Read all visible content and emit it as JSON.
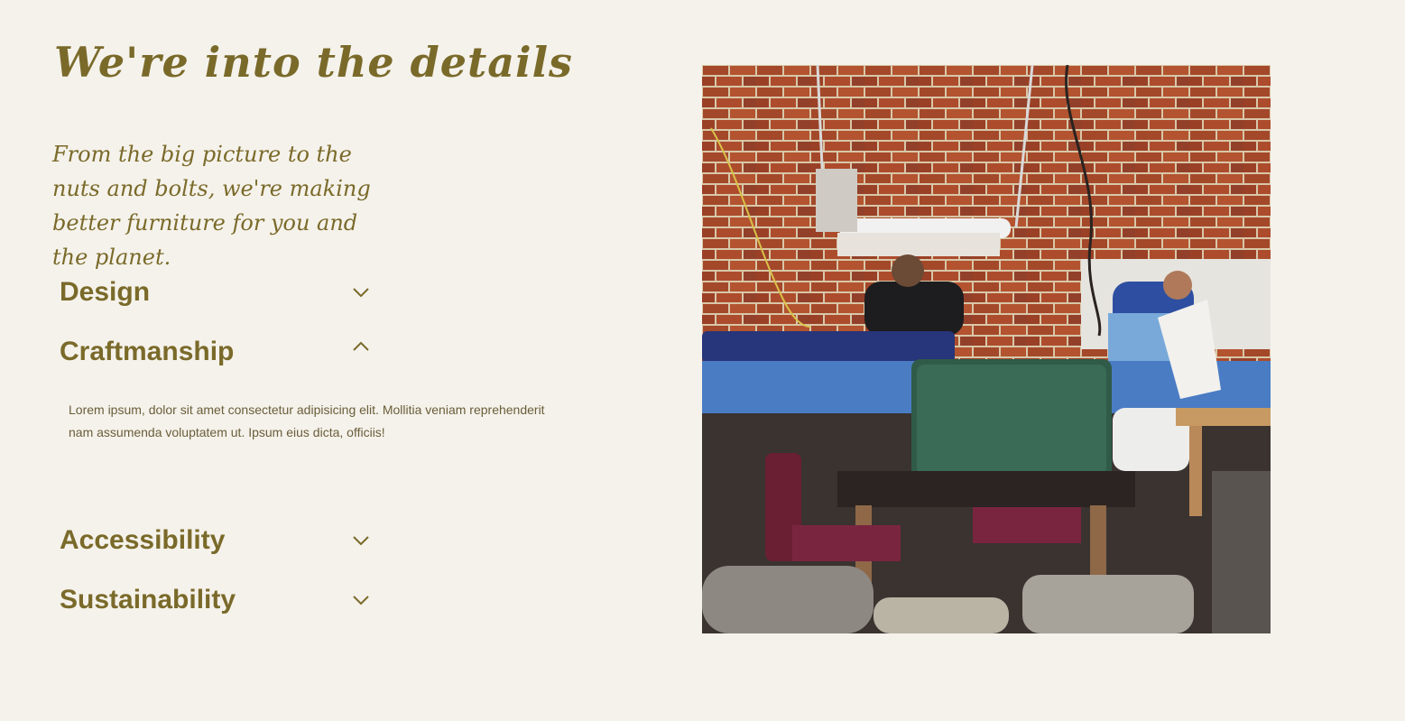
{
  "section": {
    "heading": "We're into the details",
    "subheading": "From the big picture to the nuts and bolts, we're making better furniture for you and the planet."
  },
  "accordion": {
    "items": [
      {
        "title": "Design",
        "expanded": false,
        "icon": "chevron-down-icon"
      },
      {
        "title": "Craftmanship",
        "expanded": true,
        "icon": "chevron-up-icon",
        "body": "Lorem ipsum, dolor sit amet consectetur adipisicing elit. Mollitia veniam reprehenderit nam assumenda voluptatem ut. Ipsum eius dicta, officiis!"
      },
      {
        "title": "Accessibility",
        "expanded": false,
        "icon": "chevron-down-icon"
      },
      {
        "title": "Sustainability",
        "expanded": false,
        "icon": "chevron-down-icon"
      }
    ]
  },
  "colors": {
    "background": "#f5f2eb",
    "accent": "#7a6a2a",
    "body_text": "#6a5d3a"
  }
}
